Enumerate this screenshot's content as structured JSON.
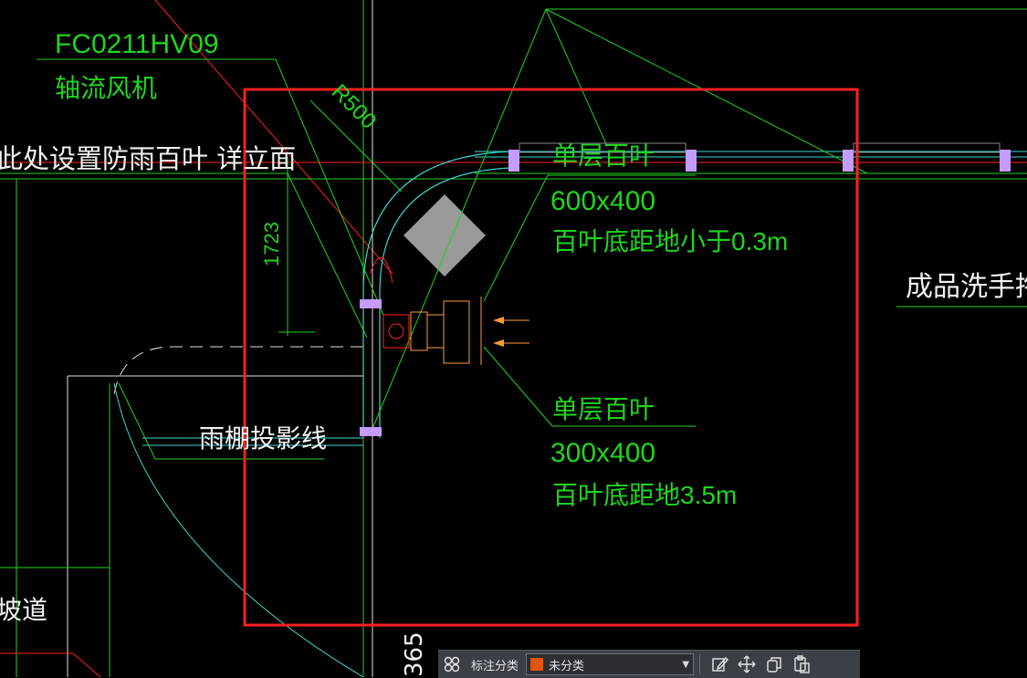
{
  "drawing": {
    "fan_code": "FC0211HV09",
    "fan_name": "轴流风机",
    "radius_label": "R500",
    "rain_louver_note": "此处设置防雨百叶 详立面",
    "dim_1723": "1723",
    "louver_top_title": "单层百叶",
    "louver_top_size": "600x400",
    "louver_top_note": "百叶底距地小于0.3m",
    "louver_bottom_title": "单层百叶",
    "louver_bottom_size": "300x400",
    "louver_bottom_note": "百叶底距地3.5m",
    "rain_shed_line": "雨棚投影线",
    "room_name": "成品洗手拖",
    "ramp": "坡道",
    "dim_bottom": "365"
  },
  "colors": {
    "green": "#1fd51f",
    "cyan": "#3fd3d3",
    "red_frame": "#ff2020",
    "magenta": "#c49cff",
    "orange": "#ff9a3a",
    "grey_fill": "#9a9a9a"
  },
  "toolbar": {
    "category_label": "标注分类",
    "selected_category": "未分类",
    "swatch_color": "#e0550b"
  }
}
